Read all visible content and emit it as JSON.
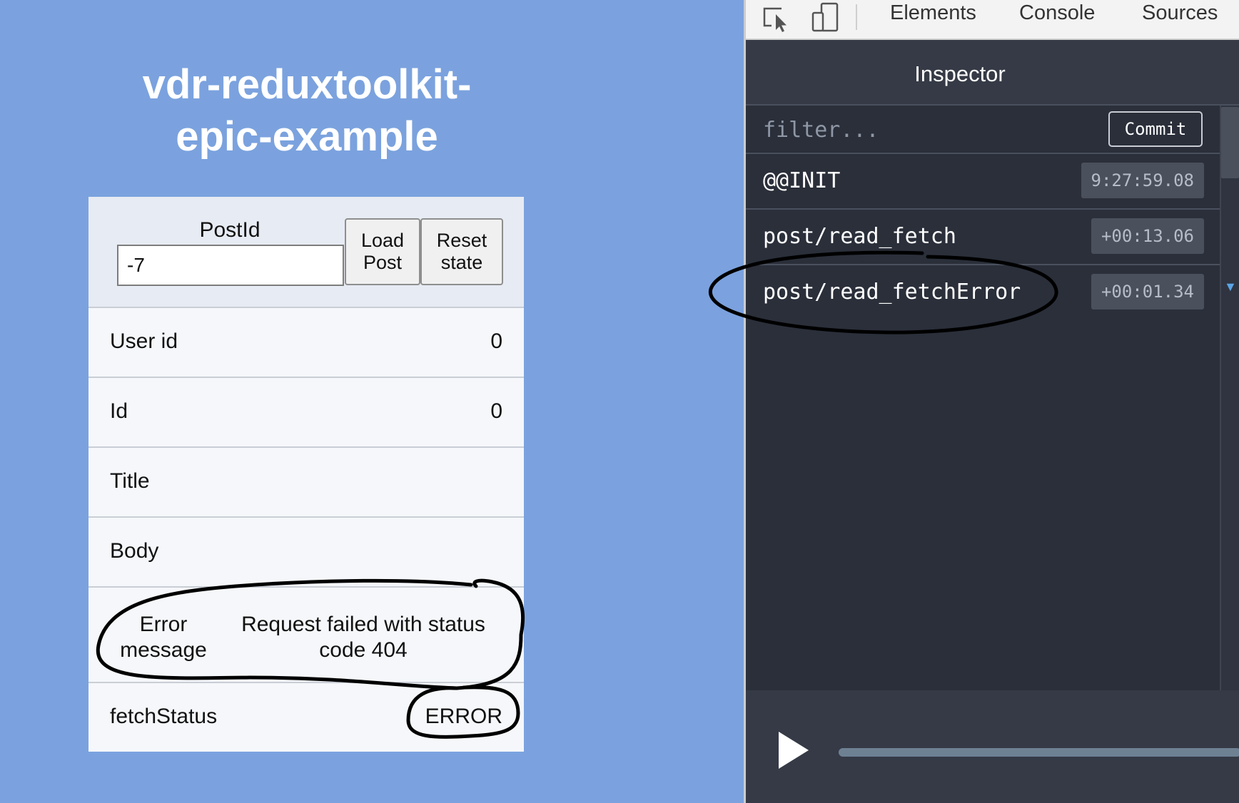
{
  "app": {
    "title": "vdr-reduxtoolkit-epic-example",
    "controls": {
      "postid_label": "PostId",
      "postid_value": "-7",
      "load_button": "Load Post",
      "reset_button": "Reset state"
    },
    "fields": {
      "user_id": {
        "label": "User id",
        "value": "0"
      },
      "id": {
        "label": "Id",
        "value": "0"
      },
      "title": {
        "label": "Title",
        "value": ""
      },
      "body": {
        "label": "Body",
        "value": ""
      },
      "error": {
        "label": "Error message",
        "value": "Request failed with status code 404"
      },
      "fetch_status": {
        "label": "fetchStatus",
        "value": "ERROR"
      }
    }
  },
  "devtools": {
    "tabs": [
      "Elements",
      "Console",
      "Sources"
    ],
    "inspector_title": "Inspector",
    "filter_placeholder": "filter...",
    "commit_label": "Commit",
    "actions": [
      {
        "name": "@@INIT",
        "time": "9:27:59.08"
      },
      {
        "name": "post/read_fetch",
        "time": "+00:13.06"
      },
      {
        "name": "post/read_fetchError",
        "time": "+00:01.34"
      }
    ]
  },
  "colors": {
    "app_background": "#7ba2de",
    "devtools_background": "#2a2f3a",
    "annotation_ink": "#000000"
  }
}
